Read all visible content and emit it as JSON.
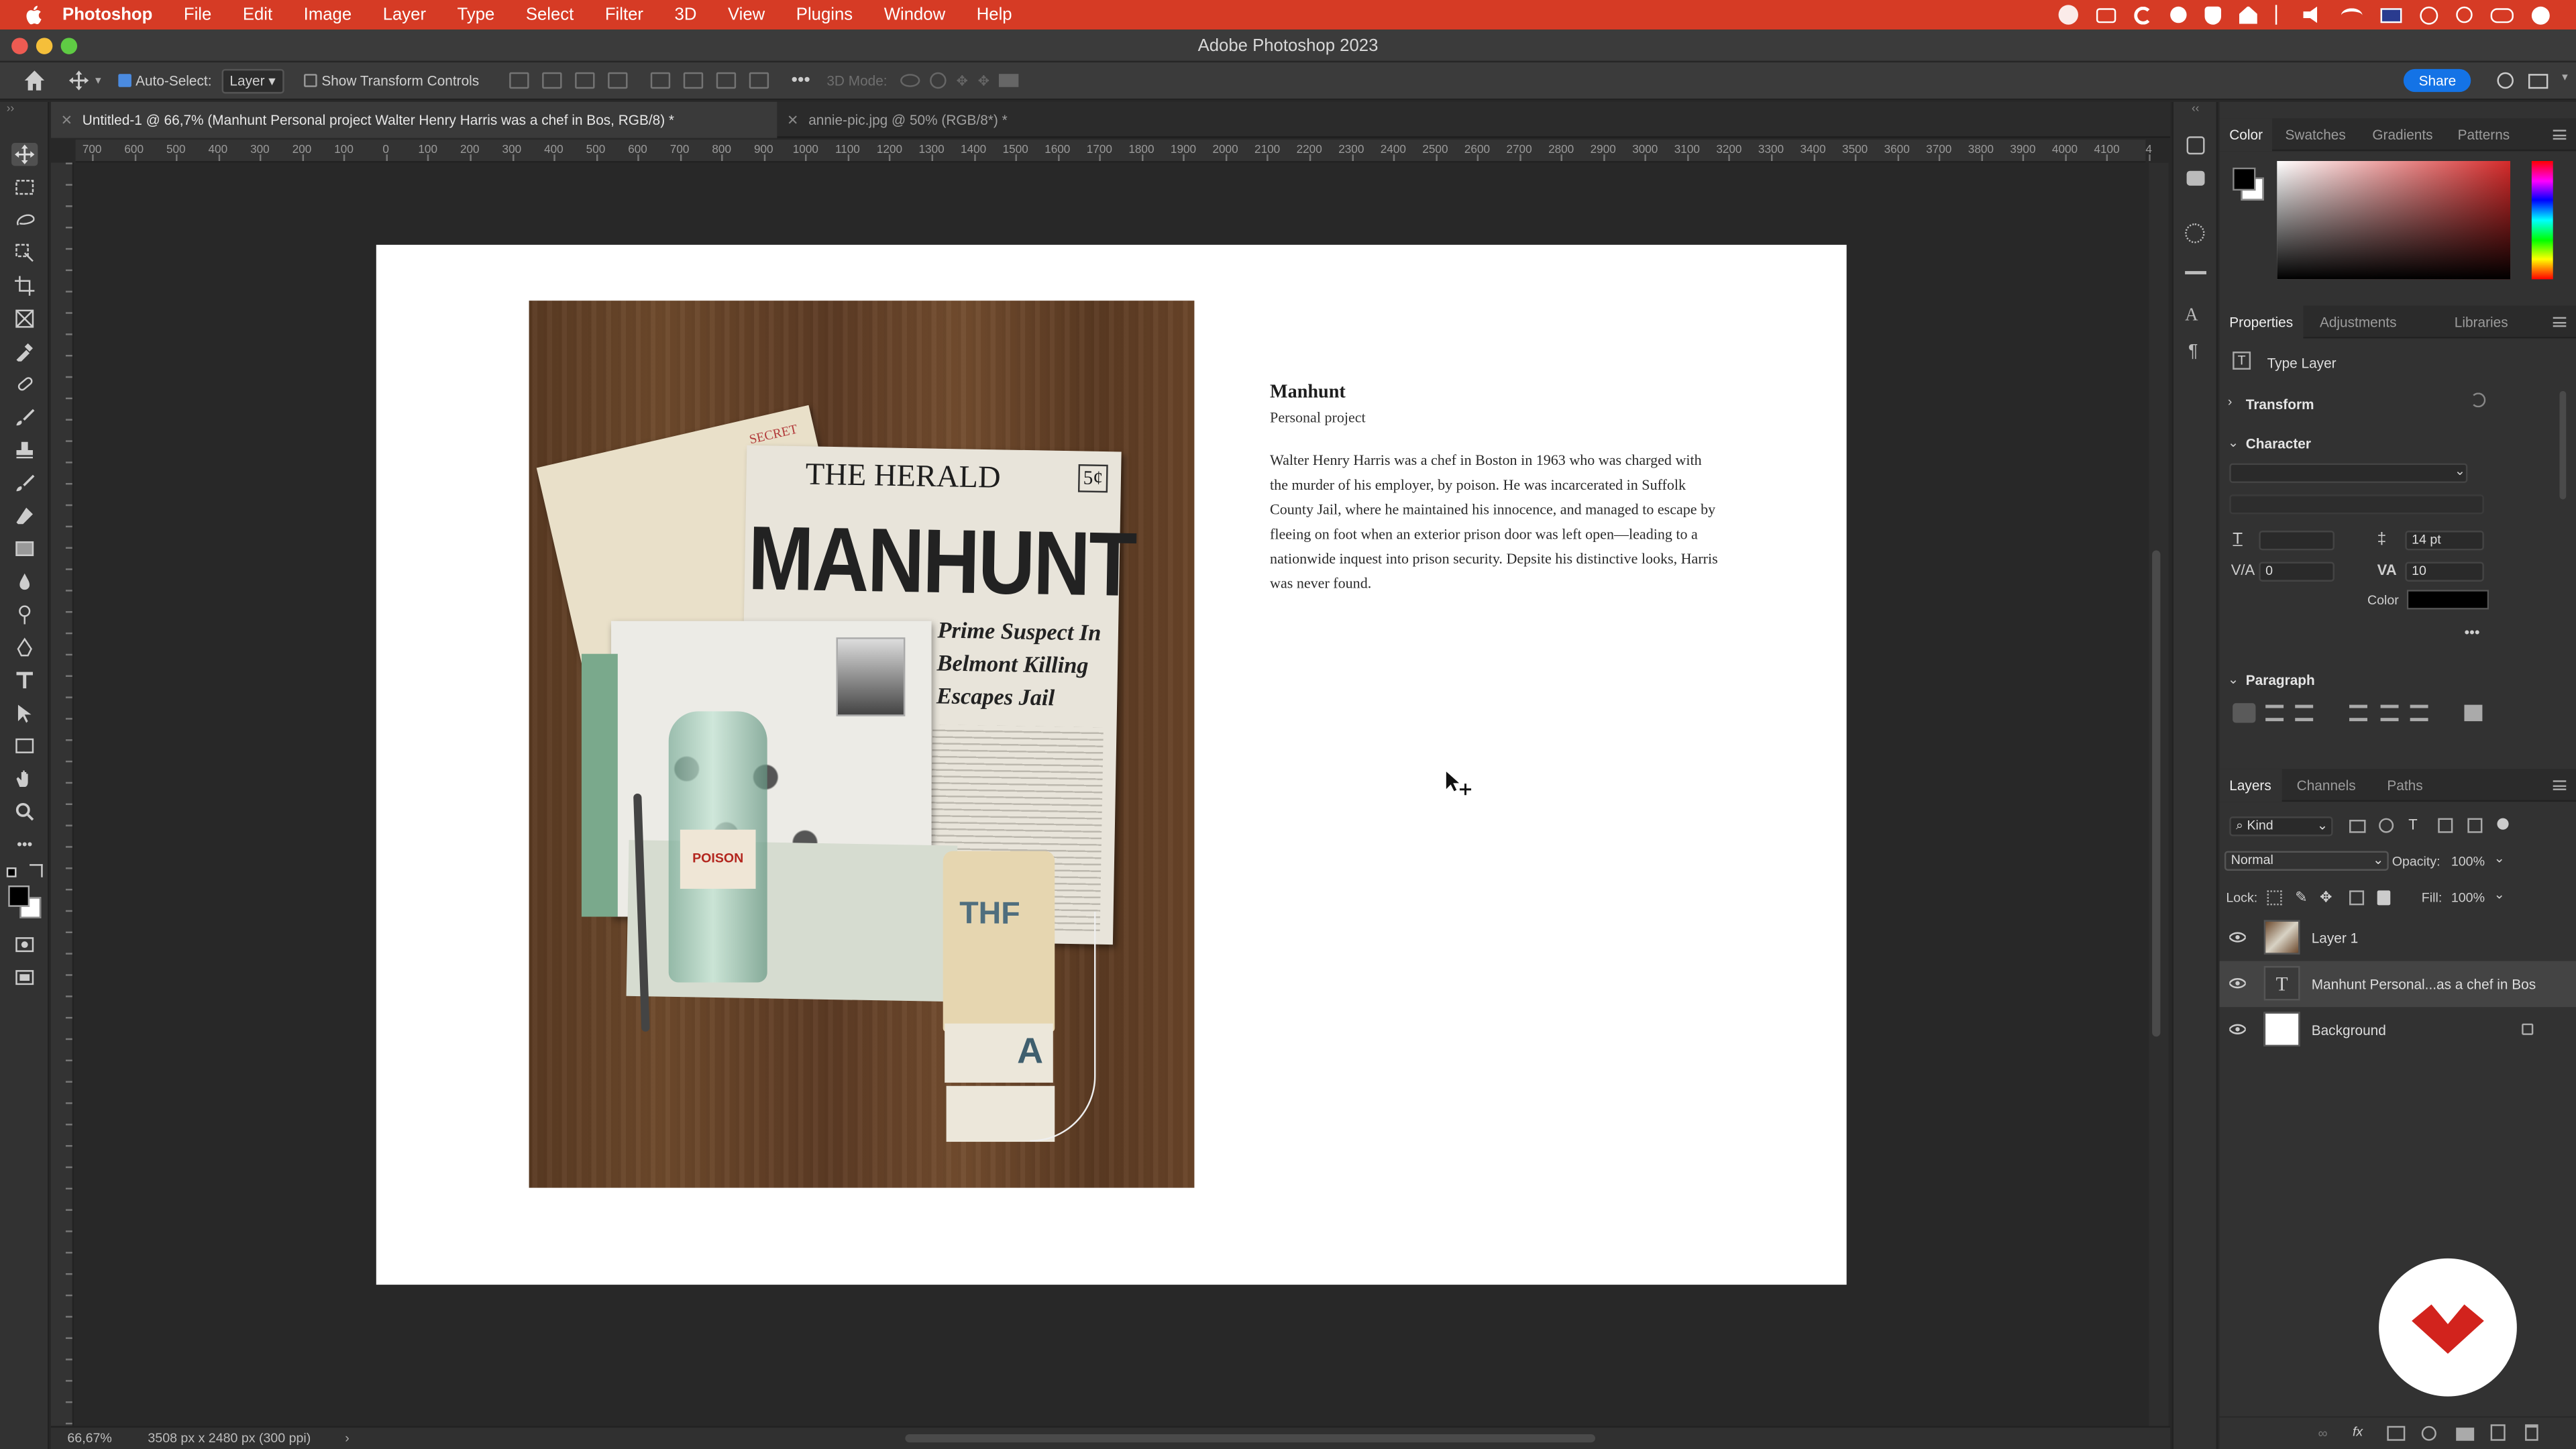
{
  "menubar": {
    "app": "Photoshop",
    "items": [
      "File",
      "Edit",
      "Image",
      "Layer",
      "Type",
      "Select",
      "Filter",
      "3D",
      "View",
      "Plugins",
      "Window",
      "Help"
    ]
  },
  "window": {
    "title": "Adobe Photoshop 2023"
  },
  "options": {
    "auto_select_label": "Auto-Select:",
    "auto_select_value": "Layer",
    "show_transform_label": "Show Transform Controls",
    "mode_3d": "3D Mode:",
    "share": "Share"
  },
  "tabs": [
    {
      "label": "Untitled-1 @ 66,7% (Manhunt Personal project  Walter Henry Harris was a chef in Bos, RGB/8) *"
    },
    {
      "label": "annie-pic.jpg @ 50% (RGB/8*) *"
    }
  ],
  "ruler": {
    "h_labels": [
      "700",
      "600",
      "500",
      "400",
      "300",
      "200",
      "100",
      "0",
      "100",
      "200",
      "300",
      "400",
      "500",
      "600",
      "700",
      "800",
      "900",
      "1000",
      "1100",
      "1200",
      "1300",
      "1400",
      "1500",
      "1600",
      "1700",
      "1800",
      "1900",
      "2000",
      "2100",
      "2200",
      "2300",
      "2400",
      "2500",
      "2600",
      "2700",
      "2800",
      "2900",
      "3000",
      "3100",
      "3200",
      "3300",
      "3400",
      "3500",
      "3600",
      "3700",
      "3800",
      "3900",
      "4000",
      "4100",
      "4"
    ]
  },
  "artwork": {
    "title": "Manhunt",
    "subtitle": "Personal project",
    "body": "Walter Henry Harris was a chef in Boston in 1963 who was charged with the murder of his employer, by poison. He was incarcerated in Suffolk County Jail, where he maintained his innocence, and managed to escape by fleeing on foot when an exterior prison door was left open—leading to a nationwide inquest into prison security. Depsite his distinctive looks, Harris was never found.",
    "photo": {
      "secret": "SECRET",
      "newspaper": "THE HERALD",
      "price": "5¢",
      "headline": "MANHUNT",
      "subhead_1": "Prime Suspect In",
      "subhead_2": "Belmont Killing",
      "subhead_3": "Escapes Jail",
      "bottle_label": "POISON",
      "tag_1": "THF",
      "tag_2": "A"
    }
  },
  "status": {
    "zoom": "66,67%",
    "doc_size": "3508 px x 2480 px (300 ppi)"
  },
  "panels": {
    "color_tabs": [
      "Color",
      "Swatches",
      "Gradients",
      "Patterns"
    ],
    "props_tabs": [
      "Properties",
      "Adjustments",
      "Libraries"
    ],
    "type_layer": "Type Layer",
    "transform": "Transform",
    "character": "Character",
    "font_size": "14 pt",
    "kerning": "0",
    "tracking": "10",
    "color_label": "Color",
    "paragraph": "Paragraph",
    "layers_tabs": [
      "Layers",
      "Channels",
      "Paths"
    ],
    "kind": "Kind",
    "blend_mode": "Normal",
    "opacity_label": "Opacity:",
    "opacity": "100%",
    "lock_label": "Lock:",
    "fill_label": "Fill:",
    "fill": "100%",
    "layers": [
      {
        "name": "Layer 1"
      },
      {
        "name": "Manhunt Personal...as a chef in Bos"
      },
      {
        "name": "Background"
      }
    ]
  },
  "colors": {
    "menubar": "#d63b25",
    "accent": "#1473e6",
    "badge": "#d2231d"
  }
}
